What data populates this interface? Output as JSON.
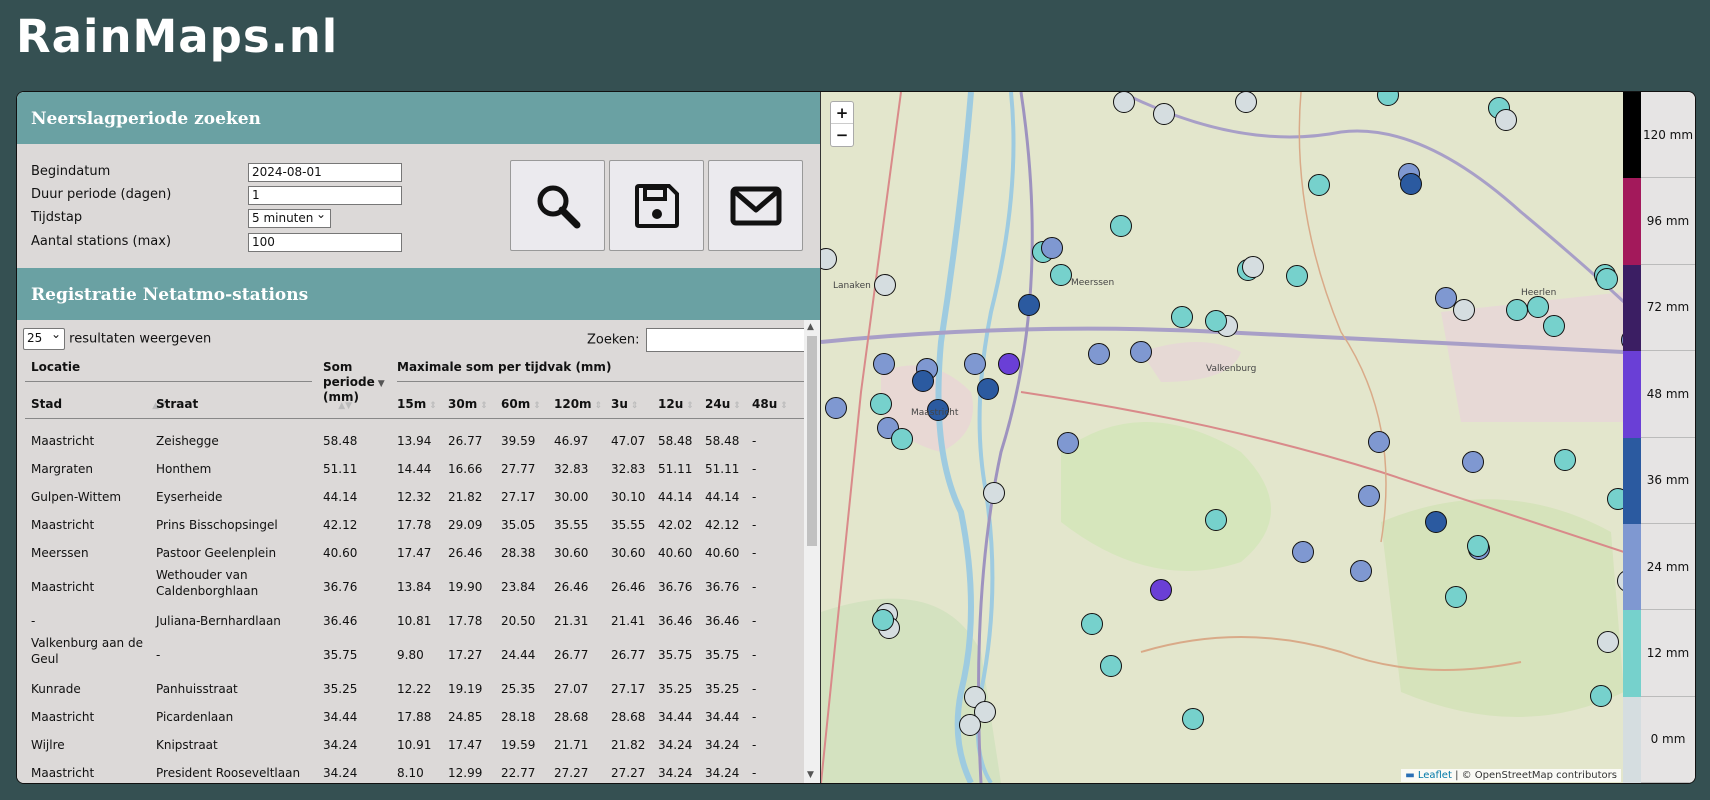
{
  "site": {
    "title": "RainMaps.nl"
  },
  "search_section": {
    "title": "Neerslagperiode zoeken",
    "fields": [
      {
        "label": "Begindatum",
        "value": "2024-08-01"
      },
      {
        "label": "Duur periode (dagen)",
        "value": "1"
      },
      {
        "label": "Tijdstap",
        "value": "5 minuten"
      },
      {
        "label": "Aantal stations (max)",
        "value": "100"
      }
    ],
    "buttons": [
      "search-icon",
      "save-icon",
      "mail-icon"
    ]
  },
  "registry_section": {
    "title": "Registratie Netatmo-stations",
    "length_value": "25",
    "length_label": "resultaten weergeven",
    "search_label": "Zoeken:",
    "group_headers": {
      "location": "Locatie",
      "sum": "Som",
      "max": "Maximale som per tijdvak (mm)"
    },
    "sum_sub": [
      "periode",
      "(mm)"
    ],
    "columns": [
      "Stad",
      "Straat",
      "15m",
      "30m",
      "60m",
      "120m",
      "3u",
      "12u",
      "24u",
      "48u"
    ],
    "rows": [
      {
        "stad": "Maastricht",
        "straat": "Zeishegge",
        "som": "58.48",
        "v": [
          "13.94",
          "26.77",
          "39.59",
          "46.97",
          "47.07",
          "58.48",
          "58.48",
          "-"
        ]
      },
      {
        "stad": "Margraten",
        "straat": "Honthem",
        "som": "51.11",
        "v": [
          "14.44",
          "16.66",
          "27.77",
          "32.83",
          "32.83",
          "51.11",
          "51.11",
          "-"
        ]
      },
      {
        "stad": "Gulpen-Wittem",
        "straat": "Eyserheide",
        "som": "44.14",
        "v": [
          "12.32",
          "21.82",
          "27.17",
          "30.00",
          "30.10",
          "44.14",
          "44.14",
          "-"
        ]
      },
      {
        "stad": "Maastricht",
        "straat": "Prins Bisschopsingel",
        "som": "42.12",
        "v": [
          "17.78",
          "29.09",
          "35.05",
          "35.55",
          "35.55",
          "42.02",
          "42.12",
          "-"
        ]
      },
      {
        "stad": "Meerssen",
        "straat": "Pastoor Geelenplein",
        "som": "40.60",
        "v": [
          "17.47",
          "26.46",
          "28.38",
          "30.60",
          "30.60",
          "40.60",
          "40.60",
          "-"
        ]
      },
      {
        "stad": "Maastricht",
        "straat": "Wethouder van",
        "straat2": "Caldenborghlaan",
        "som": "36.76",
        "v": [
          "13.84",
          "19.90",
          "23.84",
          "26.46",
          "26.46",
          "36.76",
          "36.76",
          "-"
        ]
      },
      {
        "stad": "-",
        "straat": "Juliana-Bernhardlaan",
        "som": "36.46",
        "v": [
          "10.81",
          "17.78",
          "20.50",
          "21.31",
          "21.41",
          "36.46",
          "36.46",
          "-"
        ]
      },
      {
        "stad": "Valkenburg aan de",
        "stad2": "Geul",
        "straat": "-",
        "som": "35.75",
        "v": [
          "9.80",
          "17.27",
          "24.44",
          "26.77",
          "26.77",
          "35.75",
          "35.75",
          "-"
        ]
      },
      {
        "stad": "Kunrade",
        "straat": "Panhuisstraat",
        "som": "35.25",
        "v": [
          "12.22",
          "19.19",
          "25.35",
          "27.07",
          "27.17",
          "35.25",
          "35.25",
          "-"
        ]
      },
      {
        "stad": "Maastricht",
        "straat": "Picardenlaan",
        "som": "34.44",
        "v": [
          "17.88",
          "24.85",
          "28.18",
          "28.68",
          "28.68",
          "34.44",
          "34.44",
          "-"
        ]
      },
      {
        "stad": "Wijlre",
        "straat": "Knipstraat",
        "som": "34.24",
        "v": [
          "10.91",
          "17.47",
          "19.59",
          "21.71",
          "21.82",
          "34.24",
          "34.24",
          "-"
        ]
      },
      {
        "stad": "Maastricht",
        "straat": "President Rooseveltlaan",
        "som": "34.24",
        "v": [
          "8.10",
          "12.99",
          "22.77",
          "27.27",
          "27.27",
          "34.24",
          "34.24",
          "-"
        ]
      }
    ]
  },
  "map": {
    "place_labels": [
      "Lanaken",
      "Maastricht",
      "Valkenburg",
      "Heerlen",
      "Meerssen"
    ],
    "attribution_leaflet": "Leaflet",
    "attribution_rest": "| © OpenStreetMap contributors",
    "zoom_in": "+",
    "zoom_out": "−",
    "station_levels": [
      "12 mm",
      "0 mm",
      "24 mm",
      "36 mm",
      "48 mm"
    ]
  },
  "legend": {
    "items": [
      {
        "label": "120 mm",
        "color": "#000000"
      },
      {
        "label": "96 mm",
        "color": "#a3195b"
      },
      {
        "label": "72 mm",
        "color": "#3b1e63"
      },
      {
        "label": "48 mm",
        "color": "#6a3fd6"
      },
      {
        "label": "36 mm",
        "color": "#2b5aa0"
      },
      {
        "label": "24 mm",
        "color": "#7f98d1"
      },
      {
        "label": "12 mm",
        "color": "#76d1cc"
      },
      {
        "label": "0 mm",
        "color": "#d5dde0"
      }
    ]
  }
}
